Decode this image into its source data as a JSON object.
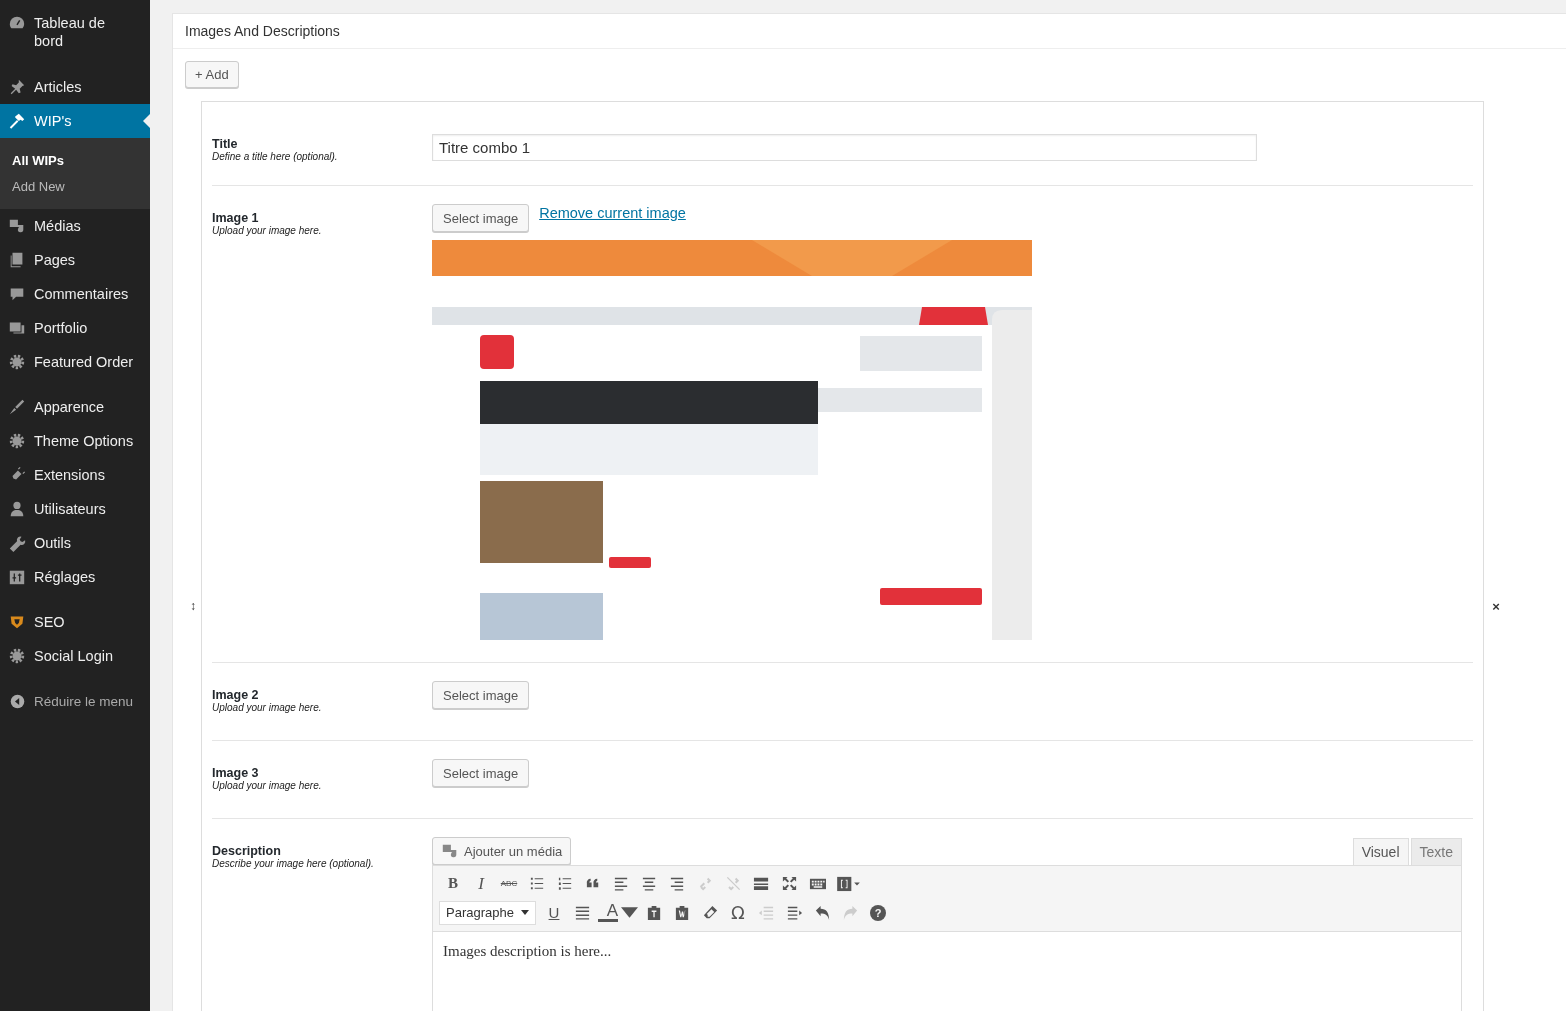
{
  "sidebar": {
    "groups": [
      [
        {
          "label": "Tableau de bord",
          "selected": false
        }
      ],
      [
        {
          "label": "Articles",
          "selected": false
        },
        {
          "label": "WIP's",
          "selected": true,
          "children": [
            {
              "label": "All WIPs",
              "selected": true
            },
            {
              "label": "Add New",
              "selected": false
            }
          ]
        },
        {
          "label": "Médias",
          "selected": false
        },
        {
          "label": "Pages",
          "selected": false
        },
        {
          "label": "Commentaires",
          "selected": false
        },
        {
          "label": "Portfolio",
          "selected": false
        },
        {
          "label": "Featured Order",
          "selected": false
        }
      ],
      [
        {
          "label": "Apparence",
          "selected": false
        },
        {
          "label": "Theme Options",
          "selected": false
        },
        {
          "label": "Extensions",
          "selected": false
        },
        {
          "label": "Utilisateurs",
          "selected": false
        },
        {
          "label": "Outils",
          "selected": false
        },
        {
          "label": "Réglages",
          "selected": false
        }
      ],
      [
        {
          "label": "SEO",
          "selected": false
        },
        {
          "label": "Social Login",
          "selected": false
        }
      ]
    ],
    "collapse": "Réduire le menu"
  },
  "panel": {
    "title": "Images And Descriptions",
    "add_button": "+ Add",
    "move_handle": "↕",
    "remove": "×"
  },
  "fields": [
    {
      "kind": "text",
      "label": "Title",
      "hint": "Define a title here (optional).",
      "value": "Titre combo 1"
    },
    {
      "label": "Image 1",
      "hint": "Upload your image here.",
      "button": "Select image",
      "remove_link": "Remove current image"
    },
    {
      "label": "Image 2",
      "hint": "Upload your image here.",
      "button": "Select image"
    },
    {
      "label": "Image 3",
      "hint": "Upload your image here.",
      "button": "Select image"
    },
    {
      "kind": "editor",
      "label": "Description",
      "hint": "Describe your image here (optional).",
      "media_button": "Ajouter un média",
      "tabs": [
        {
          "label": "Visuel",
          "selected": true
        },
        {
          "label": "Texte",
          "selected": false
        }
      ],
      "toolbar": [
        [
          {
            "kind": "bold",
            "text": "B",
            "disabled": false
          },
          {
            "kind": "italic",
            "text": "I",
            "disabled": false
          },
          {
            "kind": "strike",
            "text": "ABC",
            "disabled": false
          },
          {
            "kind": "bullets",
            "disabled": false
          },
          {
            "kind": "numbers",
            "disabled": false
          },
          {
            "kind": "quote",
            "disabled": false
          },
          {
            "kind": "left",
            "disabled": false
          },
          {
            "kind": "center",
            "disabled": false
          },
          {
            "kind": "right",
            "disabled": false
          },
          {
            "kind": "link",
            "disabled": true
          },
          {
            "kind": "unlink",
            "disabled": true
          },
          {
            "kind": "more",
            "disabled": false
          },
          {
            "kind": "fullscreen",
            "disabled": false
          },
          {
            "kind": "keyboard",
            "disabled": false
          },
          {
            "kind": "shortcode",
            "disabled": false
          }
        ],
        [
          {
            "kind": "select",
            "text": "Paragraphe",
            "disabled": false
          },
          {
            "kind": "underline",
            "text": "U",
            "disabled": false
          },
          {
            "kind": "justify",
            "disabled": false
          },
          {
            "kind": "color",
            "text": "A",
            "disabled": false
          },
          {
            "kind": "pastetext",
            "disabled": false
          },
          {
            "kind": "pasteword",
            "disabled": false
          },
          {
            "kind": "eraser",
            "disabled": false
          },
          {
            "kind": "glyph",
            "text": "Ω",
            "disabled": false
          },
          {
            "kind": "outdent",
            "disabled": true
          },
          {
            "kind": "indent",
            "disabled": false
          },
          {
            "kind": "undo",
            "disabled": false
          },
          {
            "kind": "redo",
            "disabled": true
          },
          {
            "kind": "help",
            "text": "?",
            "disabled": false
          }
        ]
      ],
      "content": "Images description is here..."
    }
  ]
}
